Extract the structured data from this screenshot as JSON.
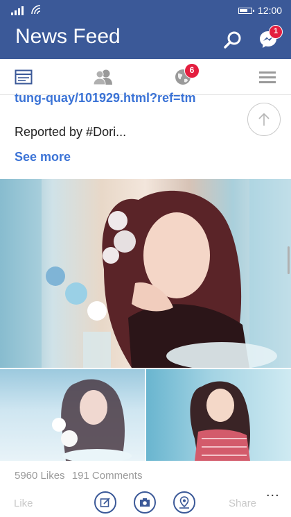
{
  "status_bar": {
    "time": "12:00",
    "icons": [
      "signal-icon",
      "wifi-icon",
      "battery-icon"
    ]
  },
  "header": {
    "title": "News Feed",
    "messenger_badge": "1",
    "icons": [
      "search-icon",
      "messenger-icon"
    ]
  },
  "tabs": {
    "items": [
      {
        "name": "tab-news-feed",
        "icon": "news-feed-icon"
      },
      {
        "name": "tab-friend-requests",
        "icon": "friends-icon"
      },
      {
        "name": "tab-notifications",
        "icon": "globe-icon"
      },
      {
        "name": "tab-menu",
        "icon": "hamburger-menu-icon"
      }
    ],
    "notifications_badge": "6"
  },
  "post": {
    "link_text": "tung-quay/101929.html?ref=tm",
    "text": "Reported by #Dori...",
    "see_more": "See more",
    "likes": "5960 Likes",
    "comments": "191 Comments"
  },
  "actions": {
    "like_label": "Like",
    "share_label": "Share",
    "more_label": "...",
    "fab_icons": [
      "compose-icon",
      "camera-icon",
      "check-in-icon"
    ]
  },
  "colors": {
    "brand": "#3b5998",
    "link": "#3b73d6",
    "badge": "#e41e3f"
  }
}
